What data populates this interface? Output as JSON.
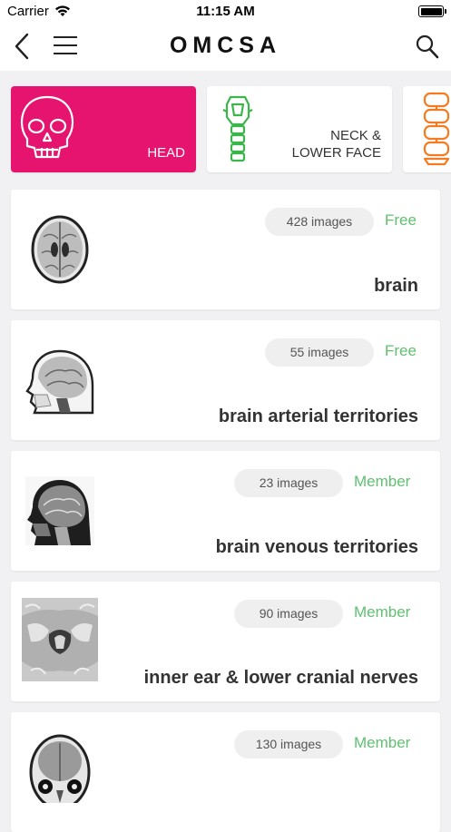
{
  "status_bar": {
    "carrier": "Carrier",
    "time": "11:15 AM"
  },
  "nav": {
    "title": "OMCSA"
  },
  "categories": [
    {
      "label": "HEAD",
      "icon": "skull-icon",
      "active": true
    },
    {
      "label_line1": "NECK &",
      "label_line2": "LOWER FACE",
      "icon": "neck-icon",
      "active": false
    },
    {
      "label": "",
      "icon": "spine-icon",
      "active": false
    }
  ],
  "items": [
    {
      "images": "428 images",
      "access": "Free",
      "title": "brain",
      "thumb": "axial-brain-thumbnail"
    },
    {
      "images": "55 images",
      "access": "Free",
      "title": "brain arterial territories",
      "thumb": "sagittal-head-thumbnail"
    },
    {
      "images": "23 images",
      "access": "Member",
      "title": "brain venous territories",
      "thumb": "sagittal-mri-thumbnail"
    },
    {
      "images": "90 images",
      "access": "Member",
      "title": "inner ear & lower cranial nerves",
      "thumb": "axial-skull-base-thumbnail"
    },
    {
      "images": "130 images",
      "access": "Member",
      "title": "",
      "thumb": "coronal-head-thumbnail"
    }
  ],
  "colors": {
    "accent": "#e6136f",
    "free_green": "#5fc16f",
    "neck_green": "#3cb54a",
    "spine_orange": "#f47b20"
  }
}
